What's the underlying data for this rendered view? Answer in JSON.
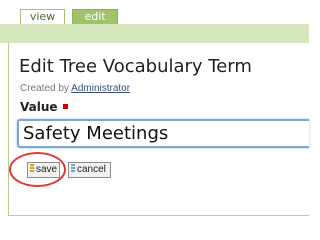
{
  "tabs": [
    {
      "label": "view",
      "active": false
    },
    {
      "label": "edit",
      "active": true
    }
  ],
  "page_title": "Edit Tree Vocabulary Term",
  "created_by": {
    "prefix": "Created by",
    "author": "Administrator"
  },
  "field": {
    "label": "Value",
    "required": true,
    "value": "Safety Meetings"
  },
  "buttons": {
    "save_label": "save",
    "cancel_label": "cancel"
  },
  "colors": {
    "accent_green": "#9fc26b",
    "header_band": "#d5e6bd",
    "input_focus_blue": "#7fa6d9",
    "required_red": "#d40000",
    "highlight_red": "#e0383a"
  }
}
